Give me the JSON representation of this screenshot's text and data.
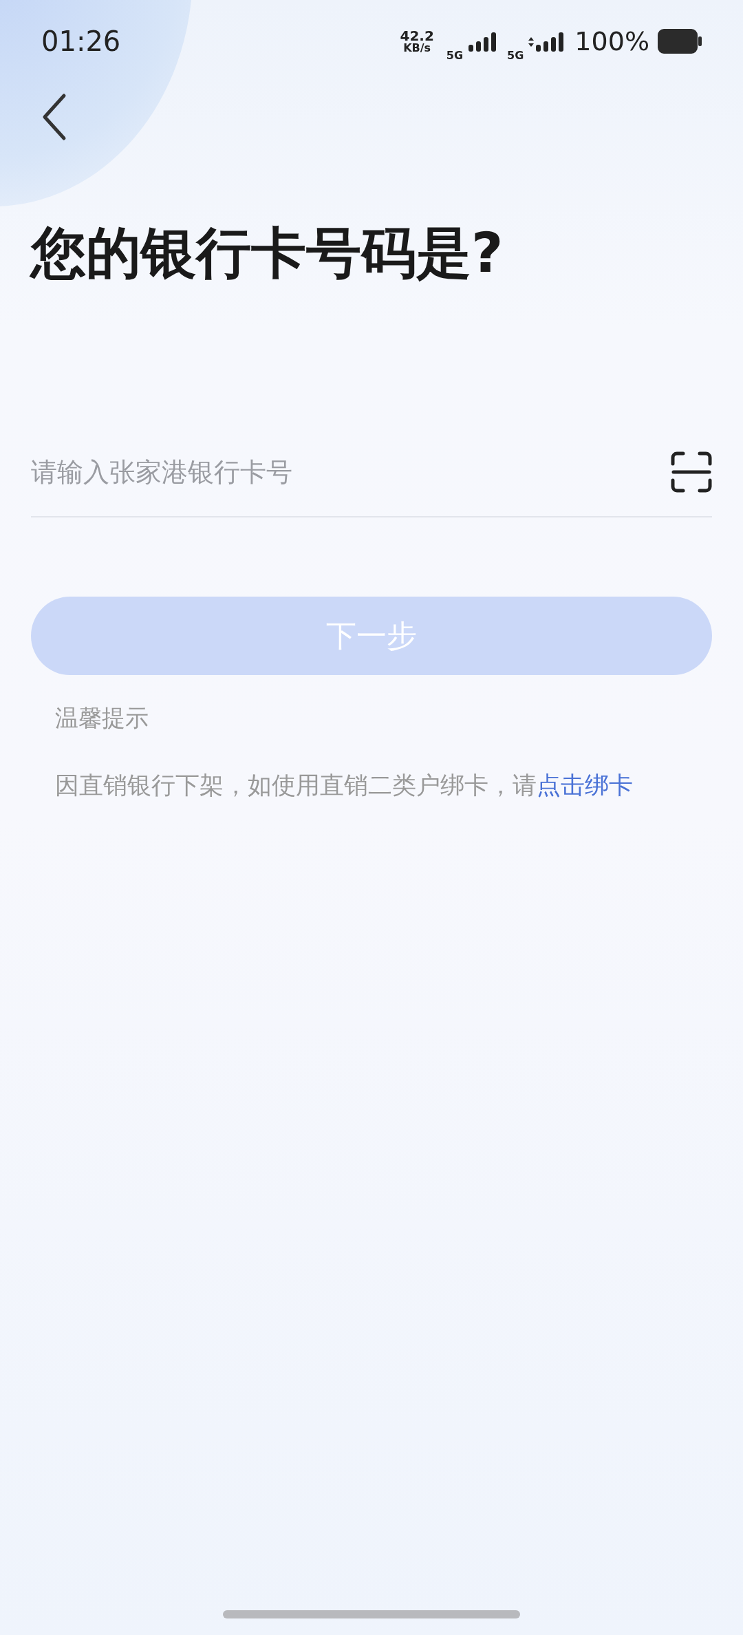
{
  "status_bar": {
    "time": "01:26",
    "speed": "42.2",
    "speed_unit": "KB/s",
    "sim_1": "5G",
    "sim_2": "5G",
    "battery": "100%"
  },
  "title": "您的银行卡号码是?",
  "card_field": {
    "placeholder": "请输入张家港银行卡号"
  },
  "next_button": {
    "label": "下一步",
    "disabled": true
  },
  "tips": {
    "heading": "温馨提示",
    "text": "因直销银行下架，如使用直销二类户绑卡，请",
    "link": "点击绑卡"
  }
}
